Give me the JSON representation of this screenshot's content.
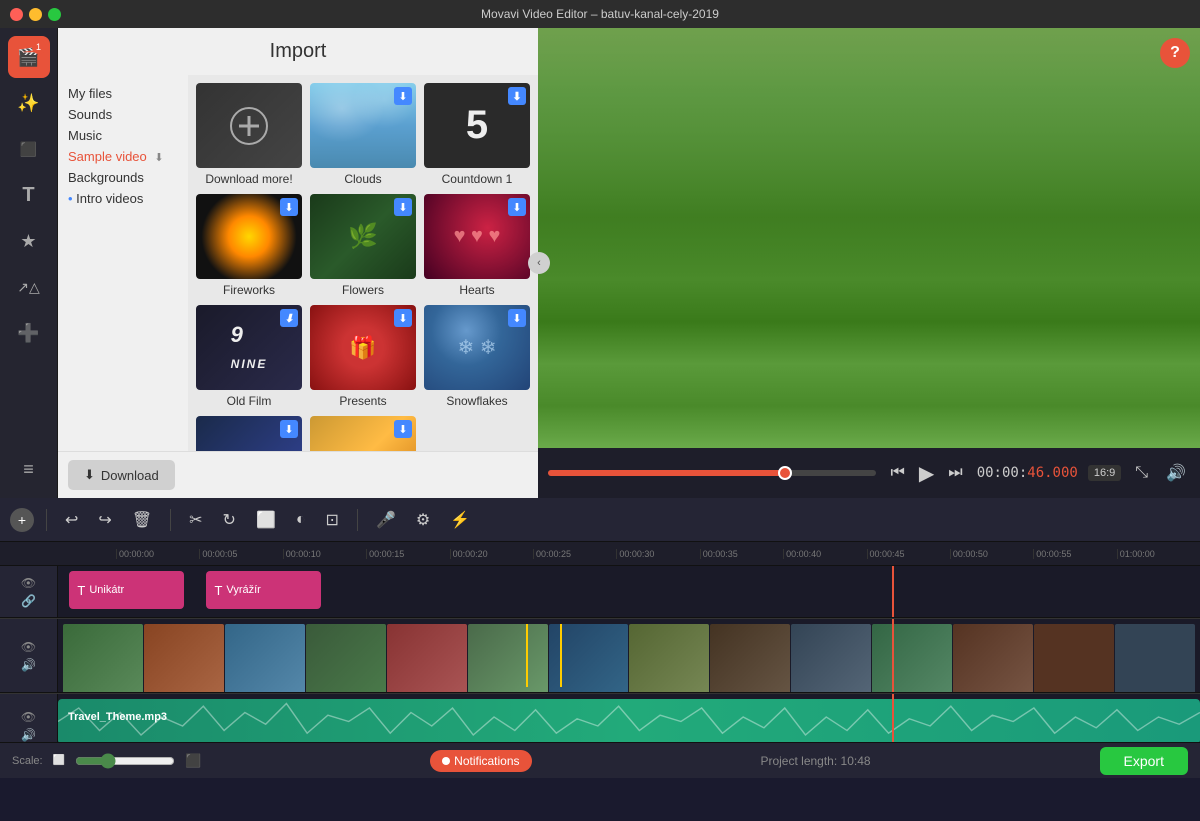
{
  "window": {
    "title": "Movavi Video Editor – batuv-kanal-cely-2019",
    "controls": [
      "close",
      "minimize",
      "maximize"
    ]
  },
  "left_toolbar": {
    "icons": [
      {
        "name": "import-media-icon",
        "symbol": "🎬",
        "active": true,
        "badge": "1"
      },
      {
        "name": "effects-icon",
        "symbol": "✨"
      },
      {
        "name": "transitions-icon",
        "symbol": "⬛"
      },
      {
        "name": "text-icon",
        "symbol": "T"
      },
      {
        "name": "filters-icon",
        "symbol": "★"
      },
      {
        "name": "motion-icon",
        "symbol": "↗"
      },
      {
        "name": "more-icon",
        "symbol": "➕"
      },
      {
        "name": "controls-icon",
        "symbol": "≡"
      }
    ]
  },
  "import_panel": {
    "title": "Import",
    "sidebar": {
      "items": [
        {
          "label": "My files",
          "active": false,
          "dot": false,
          "download": false
        },
        {
          "label": "Sounds",
          "active": false,
          "dot": false,
          "download": false
        },
        {
          "label": "Music",
          "active": false,
          "dot": false,
          "download": false
        },
        {
          "label": "Sample video",
          "active": true,
          "dot": false,
          "download": true
        },
        {
          "label": "Backgrounds",
          "active": false,
          "dot": false,
          "download": false
        },
        {
          "label": "Intro videos",
          "active": false,
          "dot": true,
          "download": false
        }
      ]
    },
    "grid": [
      {
        "id": "download-more",
        "label": "Download more!",
        "type": "special",
        "download": false
      },
      {
        "id": "clouds",
        "label": "Clouds",
        "type": "clouds",
        "download": true
      },
      {
        "id": "countdown1",
        "label": "Countdown 1",
        "type": "countdown",
        "download": true
      },
      {
        "id": "fireworks",
        "label": "Fireworks",
        "type": "fireworks",
        "download": true
      },
      {
        "id": "flowers",
        "label": "Flowers",
        "type": "flowers",
        "download": true
      },
      {
        "id": "hearts",
        "label": "Hearts",
        "type": "hearts",
        "download": true
      },
      {
        "id": "old-film",
        "label": "Old Film",
        "type": "old-film",
        "download": true
      },
      {
        "id": "presents",
        "label": "Presents",
        "type": "presents",
        "download": true
      },
      {
        "id": "snowflakes",
        "label": "Snowflakes",
        "type": "snowflakes",
        "download": true
      },
      {
        "id": "partial1",
        "label": "",
        "type": "partial1",
        "download": true
      },
      {
        "id": "partial2",
        "label": "",
        "type": "partial2",
        "download": true
      }
    ],
    "download_button": "Download",
    "collapse_label": "<"
  },
  "preview": {
    "help_label": "?",
    "time_current": "00:00:46.000",
    "time_accent": "46.000",
    "time_prefix": "00:00:",
    "ratio": "16:9",
    "progress_pct": 72
  },
  "timeline": {
    "toolbar_buttons": [
      "undo",
      "redo",
      "delete",
      "cut",
      "rotate",
      "trim",
      "color",
      "crop",
      "mic",
      "settings",
      "adjust"
    ],
    "ruler_marks": [
      "00:00:00",
      "00:00:05",
      "00:00:10",
      "00:00:15",
      "00:00:20",
      "00:00:25",
      "00:00:30",
      "00:00:35",
      "00:00:40",
      "00:00:45",
      "00:00:50",
      "00:00:55",
      "01:00:00"
    ],
    "tracks": [
      {
        "type": "text",
        "clips": [
          {
            "label": "Unikátr",
            "left_pct": 1,
            "width_pct": 11
          },
          {
            "label": "Vyrážír",
            "left_pct": 13,
            "width_pct": 11
          }
        ]
      },
      {
        "type": "video",
        "frames": 12
      },
      {
        "type": "audio",
        "label": "Travel_Theme.mp3"
      }
    ],
    "playhead_pct": 73
  },
  "bottom_bar": {
    "scale_label": "Scale:",
    "notifications_label": "Notifications",
    "project_length_label": "Project length:",
    "project_length_value": "10:48",
    "export_label": "Export"
  }
}
